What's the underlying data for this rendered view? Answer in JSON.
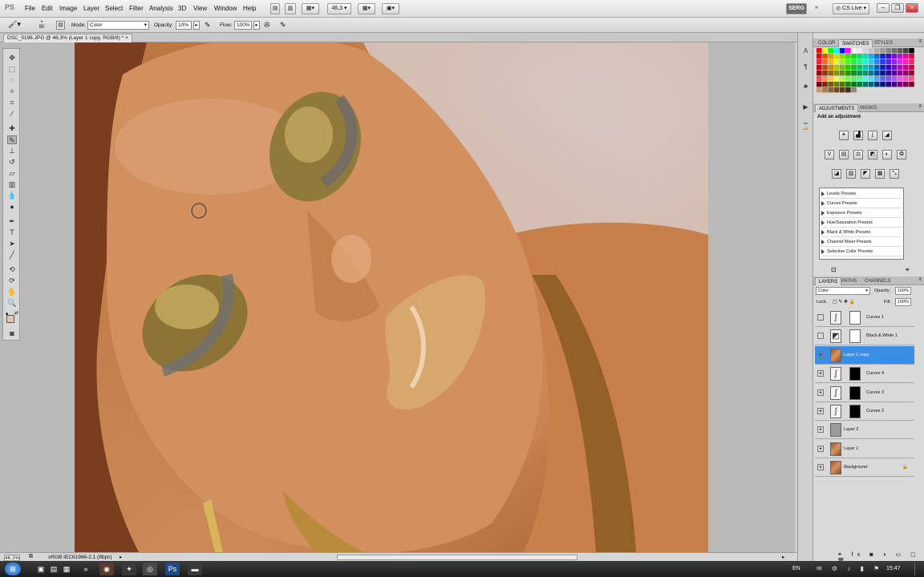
{
  "app": {
    "logo": "PS",
    "menu": [
      "File",
      "Edit",
      "Image",
      "Layer",
      "Select",
      "Filter",
      "Analysis",
      "3D",
      "View",
      "Window",
      "Help"
    ],
    "zoom_value": "46,3",
    "workspace_button": "SERG",
    "cs_live": "CS Live"
  },
  "options_bar": {
    "brush_size": "90",
    "mode_label": "Mode:",
    "mode_value": "Color",
    "opacity_label": "Opacity:",
    "opacity_value": "10%",
    "flow_label": "Flow:",
    "flow_value": "100%"
  },
  "document": {
    "tab_title": "DSC_0196.JPG @ 46,3% (Layer 1 copy, RGB/8) *",
    "close_glyph": "×"
  },
  "status": {
    "zoom": "46.3%",
    "profile": "sRGB IEC61966-2.1 (8bpc)"
  },
  "swatches_panel": {
    "tabs": [
      "COLOR",
      "SWATCHES",
      "STYLES"
    ],
    "active_tab": "SWATCHES"
  },
  "adjustments_panel": {
    "tabs": [
      "ADJUSTMENTS",
      "MASKS"
    ],
    "active_tab": "ADJUSTMENTS",
    "heading": "Add an adjustment",
    "presets": [
      "Levels Presets",
      "Curves Presets",
      "Exposure Presets",
      "Hue/Saturation Presets",
      "Black & White Presets",
      "Channel Mixer Presets",
      "Selective Color Presets"
    ]
  },
  "layers_panel": {
    "tabs": [
      "LAYERS",
      "PATHS",
      "CHANNELS"
    ],
    "active_tab": "LAYERS",
    "blend_mode": "Color",
    "opacity_label": "Opacity:",
    "opacity_value": "100%",
    "lock_label": "Lock:",
    "fill_label": "Fill:",
    "fill_value": "100%",
    "layers": [
      {
        "name": "Curves 1",
        "kind": "adjustment",
        "visible": false,
        "selected": false
      },
      {
        "name": "Black & White 1",
        "kind": "adjustment",
        "visible": false,
        "selected": false
      },
      {
        "name": "Layer 1 copy",
        "kind": "pixel",
        "visible": true,
        "selected": true
      },
      {
        "name": "Curves 4",
        "kind": "adjustment",
        "visible": true,
        "selected": false
      },
      {
        "name": "Curves 3",
        "kind": "adjustment",
        "visible": true,
        "selected": false
      },
      {
        "name": "Curves 2",
        "kind": "adjustment",
        "visible": true,
        "selected": false
      },
      {
        "name": "Layer 2",
        "kind": "gray",
        "visible": true,
        "selected": false
      },
      {
        "name": "Layer 1",
        "kind": "pixel",
        "visible": true,
        "selected": false
      },
      {
        "name": "Background",
        "kind": "pixel",
        "visible": true,
        "selected": false
      }
    ]
  },
  "taskbar": {
    "lang": "EN",
    "time": "15:47"
  },
  "colors": {
    "selected_layer": "#3a8ee6",
    "foreground_swatch": "#e7c3b3",
    "background_swatch": "#ffffff"
  }
}
